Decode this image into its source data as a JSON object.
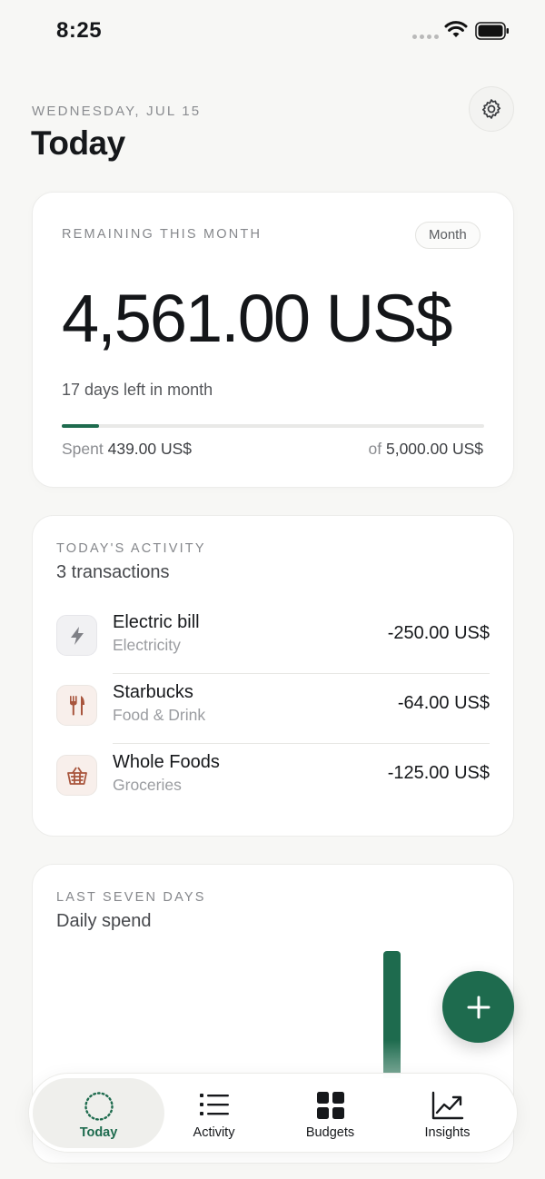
{
  "status": {
    "time": "8:25"
  },
  "header": {
    "date": "WEDNESDAY, JUL 15",
    "title": "Today"
  },
  "remaining": {
    "eyebrow": "REMAINING THIS MONTH",
    "period": "Month",
    "amount": "4,561.00 US$",
    "days_left": "17 days left in month",
    "spent_label": "Spent",
    "spent_value": "439.00 US$",
    "of_label": "of",
    "budget_value": "5,000.00 US$",
    "progress_fraction": 0.0878
  },
  "activity": {
    "eyebrow": "TODAY'S ACTIVITY",
    "subtitle": "3 transactions",
    "transactions": [
      {
        "name": "Electric bill",
        "category": "Electricity",
        "amount": "-250.00 US$",
        "icon": "lightning-icon"
      },
      {
        "name": "Starbucks",
        "category": "Food & Drink",
        "amount": "-64.00 US$",
        "icon": "fork-knife-icon"
      },
      {
        "name": "Whole Foods",
        "category": "Groceries",
        "amount": "-125.00 US$",
        "icon": "basket-icon"
      }
    ]
  },
  "seven_days": {
    "eyebrow": "LAST SEVEN DAYS",
    "subtitle": "Daily spend"
  },
  "tabs": [
    {
      "label": "Today",
      "icon": "today-ring-icon",
      "active": true
    },
    {
      "label": "Activity",
      "icon": "list-icon",
      "active": false
    },
    {
      "label": "Budgets",
      "icon": "grid-icon",
      "active": false
    },
    {
      "label": "Insights",
      "icon": "trend-chart-icon",
      "active": false
    }
  ],
  "colors": {
    "accent": "#1e6b4e",
    "background": "#f7f7f5",
    "card": "#ffffff"
  }
}
